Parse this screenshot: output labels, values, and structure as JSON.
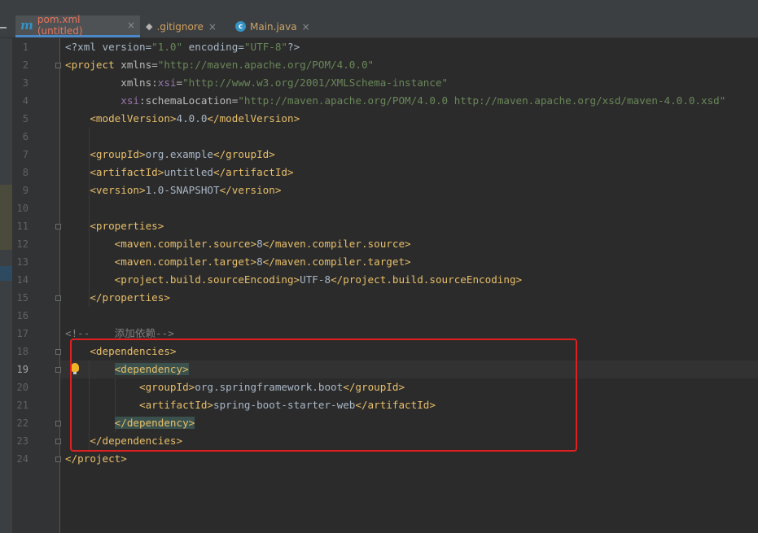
{
  "tabs": [
    {
      "icon": "m",
      "label": "pom.xml (untitled)",
      "close": "×"
    },
    {
      "icon": "git",
      "label": ".gitignore",
      "close": "×"
    },
    {
      "icon": "c",
      "label": "Main.java",
      "close": "×"
    }
  ],
  "editor": {
    "current_line": "19",
    "line_numbers": [
      "1",
      "2",
      "3",
      "4",
      "5",
      "6",
      "7",
      "8",
      "9",
      "10",
      "11",
      "12",
      "13",
      "14",
      "15",
      "16",
      "17",
      "18",
      "19",
      "20",
      "21",
      "22",
      "23",
      "24"
    ],
    "code": {
      "l1": {
        "a": "<?xml version=",
        "b": "\"1.0\"",
        "c": " encoding=",
        "d": "\"UTF-8\"",
        "e": "?>"
      },
      "l2": {
        "tag": "<project",
        "attr": " xmlns=",
        "val": "\"http://maven.apache.org/POM/4.0.0\""
      },
      "l3": {
        "attr": "xmlns:",
        "ns": "xsi",
        "eq": "=",
        "val": "\"http://www.w3.org/2001/XMLSchema-instance\""
      },
      "l4": {
        "ns": "xsi",
        "attr": ":schemaLocation=",
        "val": "\"http://maven.apache.org/POM/4.0.0 http://maven.apache.org/xsd/maven-4.0.0.xsd\""
      },
      "l5": {
        "open": "<modelVersion>",
        "text": "4.0.0",
        "close": "</modelVersion>"
      },
      "l7": {
        "open": "<groupId>",
        "text": "org.example",
        "close": "</groupId>"
      },
      "l8": {
        "open": "<artifactId>",
        "text": "untitled",
        "close": "</artifactId>"
      },
      "l9": {
        "open": "<version>",
        "text": "1.0-SNAPSHOT",
        "close": "</version>"
      },
      "l11": {
        "open": "<properties>"
      },
      "l12": {
        "open": "<maven.compiler.source>",
        "text": "8",
        "close": "</maven.compiler.source>"
      },
      "l13": {
        "open": "<maven.compiler.target>",
        "text": "8",
        "close": "</maven.compiler.target>"
      },
      "l14": {
        "open": "<project.build.sourceEncoding>",
        "text": "UTF-8",
        "close": "</project.build.sourceEncoding>"
      },
      "l15": {
        "close": "</properties>"
      },
      "l17": {
        "comment": "<!--    添加依赖-->"
      },
      "l18": {
        "open": "<dependencies>"
      },
      "l19": {
        "open": "<dependency>"
      },
      "l20": {
        "open": "<groupId>",
        "text": "org.springframework.boot",
        "close": "</groupId>"
      },
      "l21": {
        "open": "<artifactId>",
        "text": "spring-boot-starter-web",
        "close": "</artifactId>"
      },
      "l22": {
        "close": "</dependency>"
      },
      "l23": {
        "close": "</dependencies>"
      },
      "l24": {
        "close": "</project>"
      }
    }
  },
  "colors": {
    "tag": "#e8bf6a",
    "string": "#6a8759",
    "namespace": "#9876aa",
    "comment": "#808080",
    "highlight_box": "#e02020"
  }
}
